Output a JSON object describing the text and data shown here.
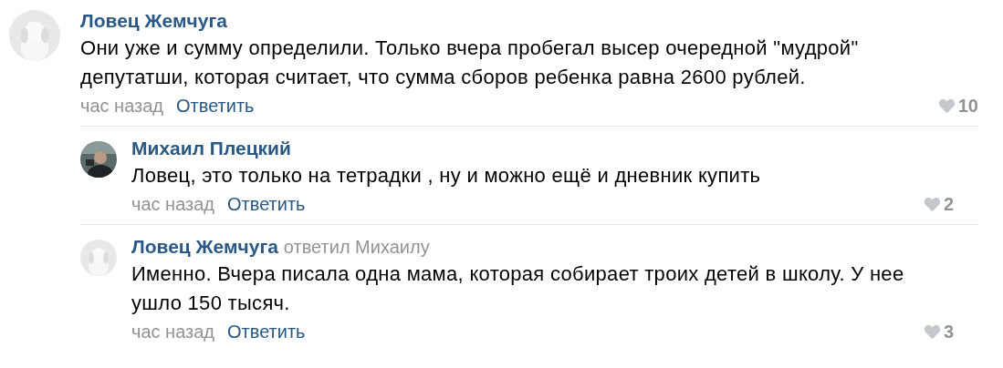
{
  "comments": [
    {
      "author": "Ловец Жемчуга",
      "text": "Они уже и сумму определили. Только вчера пробегал высер очередной \"мудрой\" депутатши, которая считает, что сумма сборов ребенка равна 2600 рублей.",
      "time": "час назад",
      "reply": "Ответить",
      "likes": "10",
      "children": [
        {
          "author": "Михаил Плецкий",
          "text": "Ловец, это только на тетрадки , ну и можно ещё и дневник купить",
          "time": "час назад",
          "reply": "Ответить",
          "likes": "2"
        },
        {
          "author": "Ловец Жемчуга",
          "replied_to": "ответил Михаилу",
          "text": "Именно. Вчера писала одна мама, которая собирает троих детей в школу. У нее ушло 150 тысяч.",
          "time": "час назад",
          "reply": "Ответить",
          "likes": "3"
        }
      ]
    }
  ]
}
